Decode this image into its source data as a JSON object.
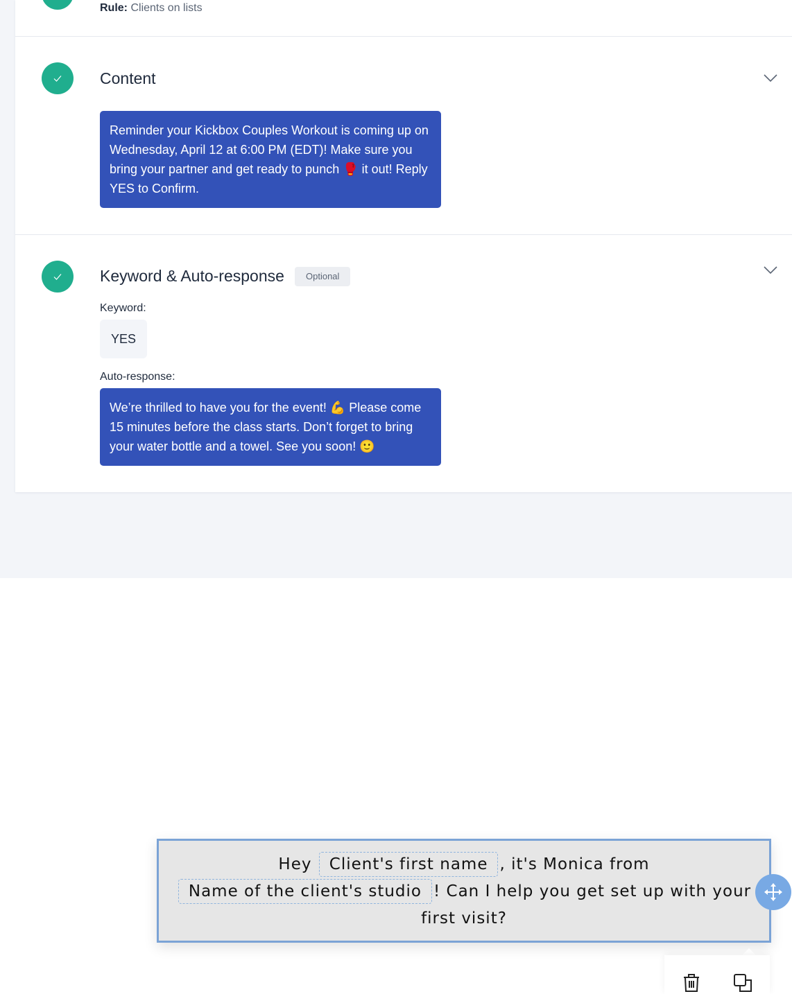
{
  "rule": {
    "label": "Rule:",
    "value": "Clients on lists"
  },
  "content_section": {
    "title": "Content",
    "message": "Reminder your Kickbox Couples Workout is coming up on Wednesday, April 12 at 6:00 PM (EDT)! Make sure you bring your partner and get ready to punch 🥊 it out! Reply YES to Confirm."
  },
  "keyword_section": {
    "title": "Keyword & Auto-response",
    "badge": "Optional",
    "keyword_label": "Keyword:",
    "keyword_value": "YES",
    "autoresponse_label": "Auto-response:",
    "autoresponse_message": "We’re thrilled to have you for the event! 💪 Please come 15 minutes before the class starts. Don’t forget to bring your water bottle and a towel. See you soon! 🙂"
  },
  "text_widget": {
    "part1": "Hey",
    "tag1": "Client's first name",
    "part2": ", it's Monica from",
    "tag2": "Name of the client's studio",
    "part3": "! Can I help you get set up with your first visit?"
  },
  "icons": {
    "check": "check-icon",
    "chevron": "chevron-down-icon",
    "move": "move-icon",
    "delete": "trash-icon",
    "duplicate": "duplicate-icon"
  },
  "colors": {
    "accent_green": "#20ae8e",
    "bubble_blue": "#3352b8",
    "handle_blue": "#78a9e4"
  }
}
